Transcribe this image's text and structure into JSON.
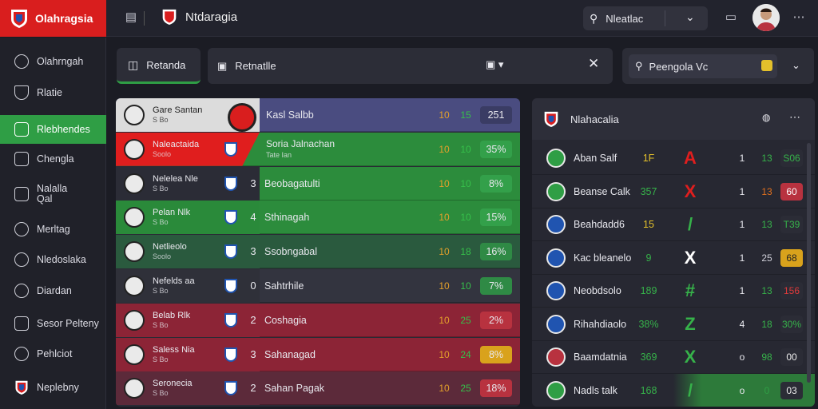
{
  "brand": {
    "title": "Olahragsia"
  },
  "header": {
    "title": "Ntdaragia",
    "search_value": "Nleatlac"
  },
  "sidebar": {
    "items": [
      {
        "label": "Olahrngah",
        "icon": "search-icon"
      },
      {
        "label": "Rlatie",
        "icon": "shield-icon"
      },
      {
        "label": "Rlebhendes",
        "icon": "table-icon"
      },
      {
        "label": "Chengla",
        "icon": "monitor-icon"
      },
      {
        "label": "Nalalla Qal",
        "icon": "calendar-icon"
      },
      {
        "label": "Merltag",
        "icon": "clock-icon"
      },
      {
        "label": "Nledoslaka",
        "icon": "shirt-icon"
      },
      {
        "label": "Diardan",
        "icon": "chat-icon"
      },
      {
        "label": "Sesor Pelteny",
        "icon": "chart-icon"
      },
      {
        "label": "Pehlciot",
        "icon": "trophy-icon"
      },
      {
        "label": "Neplebny",
        "icon": "crest-icon"
      }
    ],
    "active_index": 2
  },
  "toolbar": {
    "tab_label": "Retanda",
    "filter_label": "Retnatlle",
    "right_search_value": "Peengola Vc"
  },
  "standings": [
    {
      "player": "Gare Santan",
      "sub": "S Bo",
      "rank": "",
      "team": "Kasl Salbb",
      "a": "10",
      "b": "15",
      "pct": "251",
      "bg": "#4a4c80",
      "leftbg": "#dcdcdc",
      "pctbg": "#3a3c64"
    },
    {
      "player": "Naleactaida",
      "sub": "Soolo",
      "rank": "",
      "team": "Soria Jalnachan",
      "sub2": "Tate Ian",
      "a": "10",
      "b": "10",
      "pct": "35%",
      "bg": "#2c8c3c",
      "leftbg": "#e01e1e",
      "pctbg": "#33a04a"
    },
    {
      "player": "Nelelea Nle",
      "sub": "S Bo",
      "rank": "3",
      "team": "Beobagatulti",
      "a": "10",
      "b": "10",
      "pct": "8%",
      "bg": "#2c8c3c",
      "leftbg": "#2b2c36",
      "pctbg": "#33a04a"
    },
    {
      "player": "Pelan Nlk",
      "sub": "S Bo",
      "rank": "4",
      "team": "Sthinagah",
      "a": "10",
      "b": "10",
      "pct": "15%",
      "bg": "#2c8c3c",
      "leftbg": "#2a8a3a",
      "pctbg": "#33a04a"
    },
    {
      "player": "Netlieolo",
      "sub": "Soolo",
      "rank": "3",
      "team": "Ssobngabal",
      "a": "10",
      "b": "18",
      "pct": "16%",
      "bg": "#2a5a3e",
      "leftbg": "#2a5a3e",
      "pctbg": "#2f8a45"
    },
    {
      "player": "Nefelds aa",
      "sub": "S Bo",
      "rank": "0",
      "team": "Sahtrhile",
      "a": "10",
      "b": "10",
      "pct": "7%",
      "bg": "#33343f",
      "leftbg": "#2f3039",
      "pctbg": "#2f8a45"
    },
    {
      "player": "Belab Rlk",
      "sub": "S Bo",
      "rank": "2",
      "team": "Coshagia",
      "a": "10",
      "b": "25",
      "pct": "2%",
      "bg": "#8c2436",
      "leftbg": "#8c2436",
      "pctbg": "#b8323f"
    },
    {
      "player": "Saless Nia",
      "sub": "S Bo",
      "rank": "3",
      "team": "Sahanagad",
      "a": "10",
      "b": "24",
      "pct": "8%",
      "bg": "#8c2436",
      "leftbg": "#8c2436",
      "pctbg": "#d9a21c"
    },
    {
      "player": "Seronecia",
      "sub": "S Bo",
      "rank": "2",
      "team": "Sahan Pagak",
      "a": "10",
      "b": "25",
      "pct": "18%",
      "bg": "#5c2a3a",
      "leftbg": "#5c2a3a",
      "pctbg": "#b8323f"
    }
  ],
  "right_panel": {
    "title": "Nlahacalia",
    "rows": [
      {
        "name": "Aban Salf",
        "val": "1F",
        "valcolor": "#e3c02b",
        "mark": "A",
        "markcolor": "#e01e1e",
        "n": "1",
        "m": "13",
        "mcolor": "#36b24a",
        "pct": "S06",
        "pctbg": "#2b2c36",
        "pctcolor": "#36b24a",
        "badge": "#2f9e45"
      },
      {
        "name": "Beanse Calk",
        "val": "357",
        "valcolor": "#36b24a",
        "mark": "X",
        "markcolor": "#e01e1e",
        "n": "1",
        "m": "13",
        "mcolor": "#e0701e",
        "pct": "60",
        "pctbg": "#b8323f",
        "pctcolor": "#fff",
        "badge": "#2f9e45"
      },
      {
        "name": "Beahdadd6",
        "val": "15",
        "valcolor": "#e3c02b",
        "mark": "/",
        "markcolor": "#36b24a",
        "n": "1",
        "m": "13",
        "mcolor": "#36b24a",
        "pct": "T39",
        "pctbg": "#2b2c36",
        "pctcolor": "#36b24a",
        "badge": "#2054b0"
      },
      {
        "name": "Kac bleanelo",
        "val": "9",
        "valcolor": "#36b24a",
        "mark": "X",
        "markcolor": "#ffffff",
        "n": "1",
        "m": "25",
        "mcolor": "#cfcfd8",
        "pct": "68",
        "pctbg": "#d9a21c",
        "pctcolor": "#222",
        "badge": "#2054b0"
      },
      {
        "name": "Neobdsolo",
        "val": "189",
        "valcolor": "#36b24a",
        "mark": "#",
        "markcolor": "#36b24a",
        "n": "1",
        "m": "13",
        "mcolor": "#36b24a",
        "pct": "156",
        "pctbg": "#2b2c36",
        "pctcolor": "#e03a3a",
        "badge": "#2054b0"
      },
      {
        "name": "Rihahdiaolo",
        "val": "38%",
        "valcolor": "#36b24a",
        "mark": "Z",
        "markcolor": "#36b24a",
        "n": "4",
        "m": "18",
        "mcolor": "#36b24a",
        "pct": "30%",
        "pctbg": "#2b2c36",
        "pctcolor": "#36b24a",
        "badge": "#2054b0"
      },
      {
        "name": "Baamdatnia",
        "val": "369",
        "valcolor": "#36b24a",
        "mark": "X",
        "markcolor": "#36b24a",
        "n": "o",
        "m": "98",
        "mcolor": "#36b24a",
        "pct": "00",
        "pctbg": "#2b2c36",
        "pctcolor": "#eee",
        "badge": "#b8323f"
      },
      {
        "name": "Nadls talk",
        "val": "168",
        "valcolor": "#36b24a",
        "mark": "/",
        "markcolor": "#36b24a",
        "n": "o",
        "m": "0",
        "mcolor": "#2f9e45",
        "pct": "03",
        "pctbg": "#2b2c36",
        "pctcolor": "#eee",
        "badge": "#2f9e45"
      }
    ]
  }
}
